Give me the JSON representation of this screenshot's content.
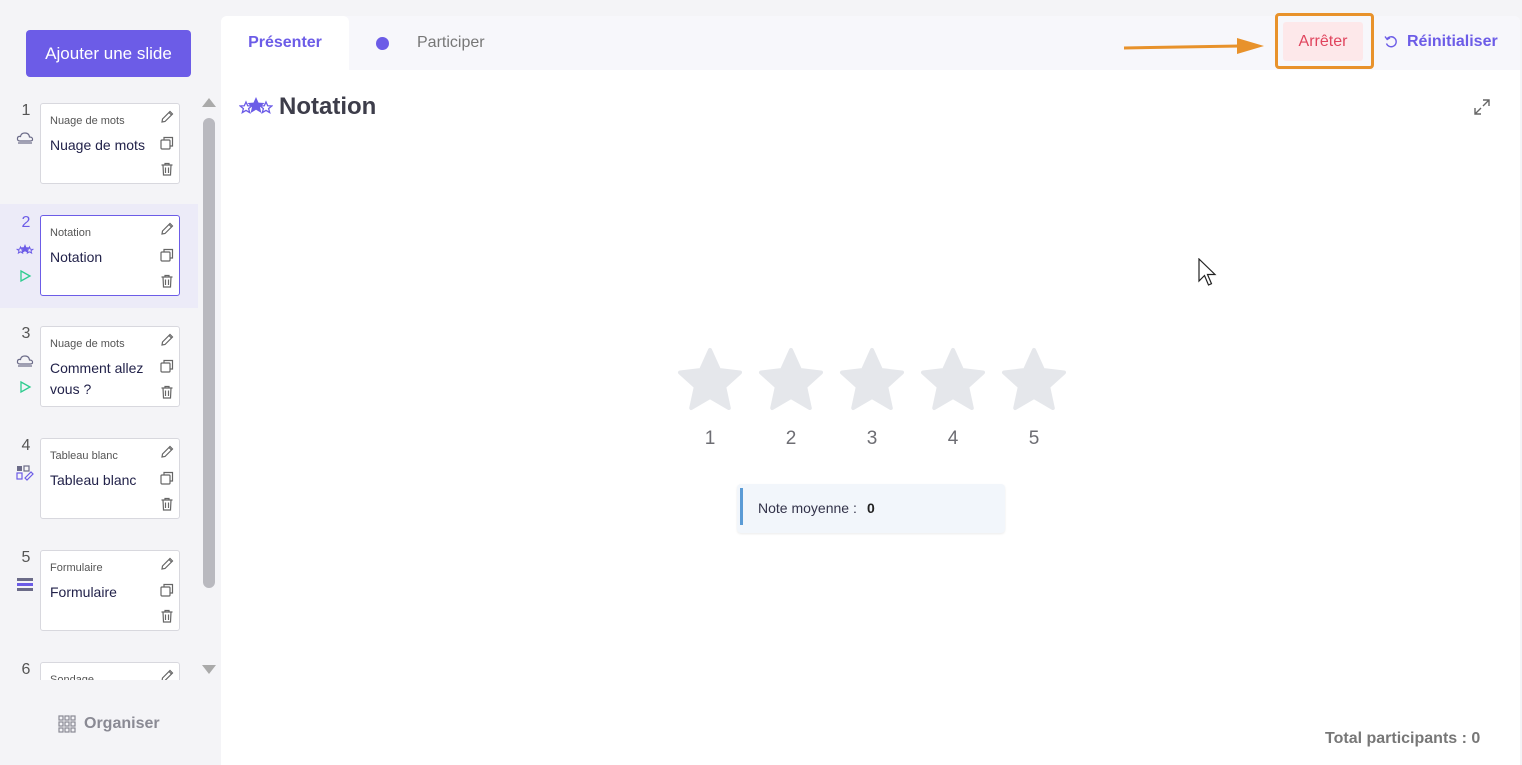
{
  "sidebar": {
    "add_slide_label": "Ajouter une slide",
    "organise_label": "Organiser",
    "slides": [
      {
        "number": "1",
        "type": "Nuage de mots",
        "title": "Nuage de mots",
        "icon": "cloud-icon",
        "playing": false
      },
      {
        "number": "2",
        "type": "Notation",
        "title": "Notation",
        "icon": "stars-icon",
        "playing": true,
        "active": true
      },
      {
        "number": "3",
        "type": "Nuage de mots",
        "title": "Comment allez vous ?",
        "icon": "cloud-icon",
        "playing": true
      },
      {
        "number": "4",
        "type": "Tableau blanc",
        "title": "Tableau blanc",
        "icon": "whiteboard-icon",
        "playing": false
      },
      {
        "number": "5",
        "type": "Formulaire",
        "title": "Formulaire",
        "icon": "form-icon",
        "playing": false
      },
      {
        "number": "6",
        "type": "Sondage",
        "title": "",
        "icon": "poll-icon",
        "playing": false
      }
    ]
  },
  "tabs": {
    "present_label": "Présenter",
    "participate_label": "Participer"
  },
  "actions": {
    "stop_label": "Arrêter",
    "reset_label": "Réinitialiser"
  },
  "main": {
    "title": "Notation",
    "star_labels": [
      "1",
      "2",
      "3",
      "4",
      "5"
    ],
    "average_label": "Note moyenne :",
    "average_value": "0",
    "total_label": "Total participants : 0"
  },
  "colors": {
    "accent": "#6c5ce7",
    "stop_text": "#e0455e",
    "stop_bg": "#fde8ea",
    "highlight": "#e8922b",
    "star": "#e5e7eb"
  }
}
